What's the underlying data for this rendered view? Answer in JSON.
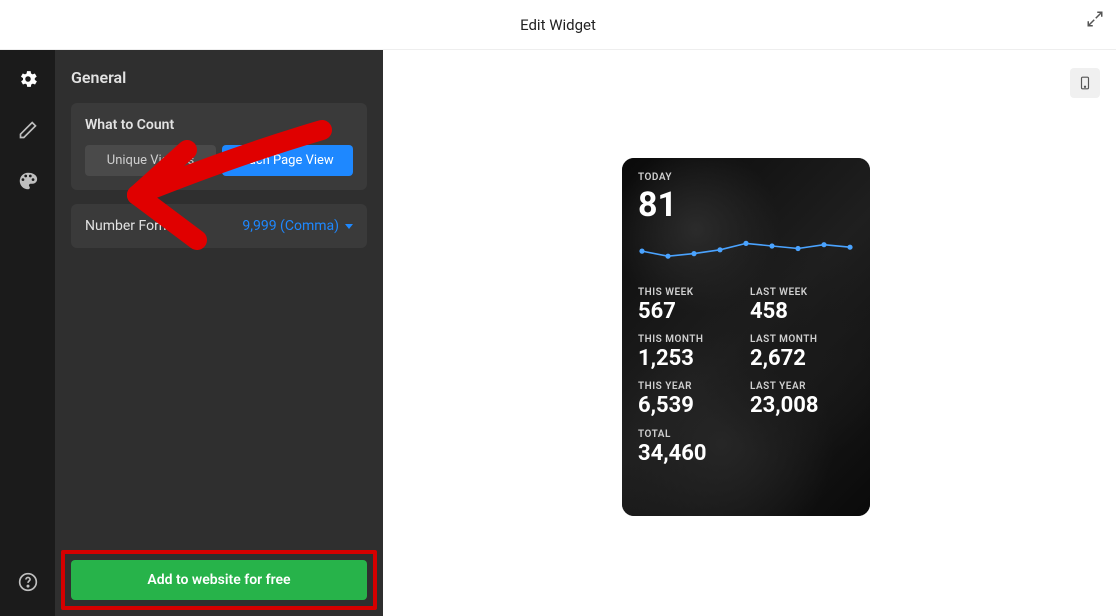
{
  "header": {
    "title": "Edit Widget"
  },
  "icons": {
    "gear": "gear-icon",
    "pencil": "pencil-icon",
    "palette": "palette-icon",
    "help": "help-icon",
    "expand": "expand-icon",
    "mobile": "mobile-icon"
  },
  "panel": {
    "title": "General",
    "what_to_count": {
      "label": "What to Count",
      "options": [
        "Unique Visitors",
        "Each Page View"
      ],
      "selected": 1
    },
    "number_format": {
      "label": "Number Format",
      "value": "9,999 (Comma)"
    },
    "cta": "Add to website for free"
  },
  "widget": {
    "today_label": "TODAY",
    "today_value": "81",
    "stats": [
      {
        "label": "THIS WEEK",
        "value": "567"
      },
      {
        "label": "LAST WEEK",
        "value": "458"
      },
      {
        "label": "THIS MONTH",
        "value": "1,253"
      },
      {
        "label": "LAST MONTH",
        "value": "2,672"
      },
      {
        "label": "THIS YEAR",
        "value": "6,539"
      },
      {
        "label": "LAST YEAR",
        "value": "23,008"
      }
    ],
    "total_label": "TOTAL",
    "total_value": "34,460"
  },
  "chart_data": {
    "type": "line",
    "x": [
      1,
      2,
      3,
      4,
      5,
      6,
      7,
      8,
      9
    ],
    "values": [
      14,
      10,
      12,
      15,
      20,
      18,
      16,
      19,
      17
    ],
    "ylim": [
      0,
      25
    ],
    "title": "",
    "xlabel": "",
    "ylabel": ""
  },
  "colors": {
    "accent": "#1e88ff",
    "cta": "#27b34a",
    "annotation": "#d60000"
  }
}
